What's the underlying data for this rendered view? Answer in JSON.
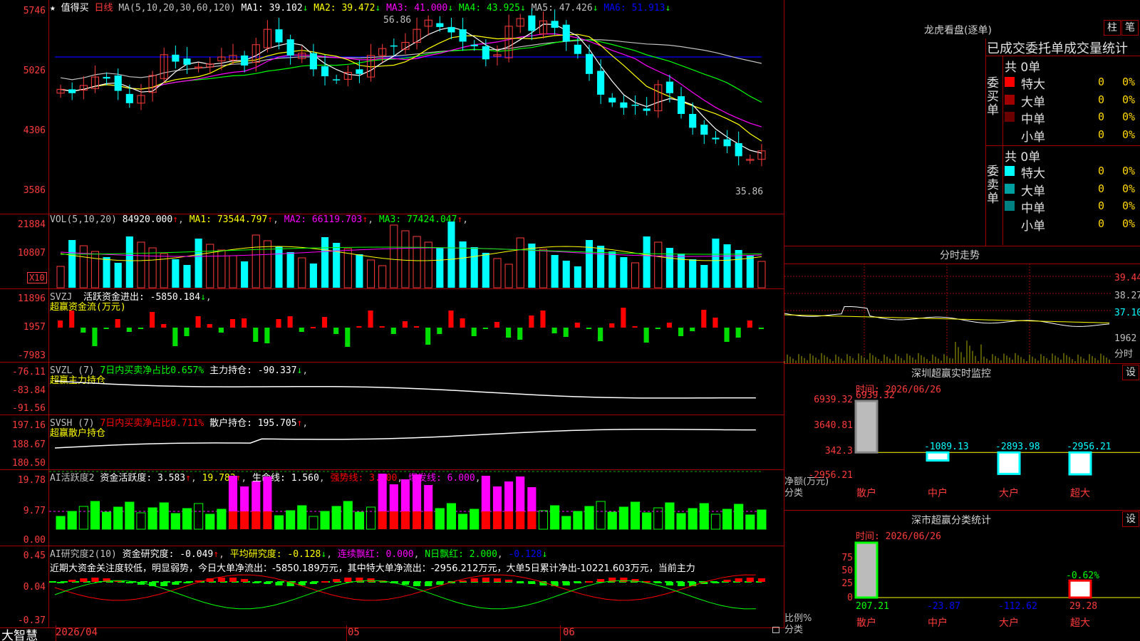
{
  "app": {
    "brand": "大智慧"
  },
  "main_chart": {
    "star": "★",
    "stock_name": "值得买",
    "period": "日线",
    "ma_params": "MA(5,10,20,30,60,120)",
    "ma_values": [
      {
        "name": "MA1:",
        "value": "39.102",
        "arrow": "↓",
        "color": "#ffffff"
      },
      {
        "name": "MA2:",
        "value": "39.472",
        "arrow": "↓",
        "color": "#ffff00"
      },
      {
        "name": "MA3:",
        "value": "41.000",
        "arrow": "↓",
        "color": "#ff00ff"
      },
      {
        "name": "MA4:",
        "value": "43.925",
        "arrow": "↓",
        "color": "#00ff00"
      },
      {
        "name": "MA5:",
        "value": "47.426",
        "arrow": "↓",
        "color": "#c0c0c0"
      },
      {
        "name": "MA6:",
        "value": "51.913",
        "arrow": "↓",
        "color": "#0000ff"
      }
    ],
    "price_axis": [
      "5746",
      "5026",
      "4306",
      "3586"
    ],
    "high_label": "56.86",
    "low_label": "35.86",
    "date_axis": [
      "2026/04",
      "05",
      "06"
    ]
  },
  "vol_panel": {
    "title": "VOL(5,10,20)",
    "value": "84920.000",
    "arrow": "↑",
    "ma": [
      {
        "name": "MA1:",
        "value": "73544.797",
        "arrow": "↑",
        "color": "#ffff00"
      },
      {
        "name": "MA2:",
        "value": "66119.703",
        "arrow": "↑",
        "color": "#ff00ff"
      },
      {
        "name": "MA3:",
        "value": "77424.047",
        "arrow": "↑",
        "color": "#00ff00"
      }
    ],
    "axis": [
      "21884",
      "10807"
    ],
    "unit": "X10"
  },
  "svzj_panel": {
    "title": "SVZJ",
    "label": "活跃资金进出:",
    "value": "-5850.184",
    "arrow": "↓",
    "subtitle": "超赢资金流(万元)",
    "axis": [
      "11896",
      "1957",
      "-7983"
    ]
  },
  "svzl_panel": {
    "title": "SVZL (7)",
    "desc": "7日内买卖净占比0.657%",
    "label": "主力持仓:",
    "value": "-90.337",
    "arrow": "↓",
    "subtitle": "超赢主力持仓",
    "axis": [
      "-76.11",
      "-83.84",
      "-91.56"
    ]
  },
  "svsh_panel": {
    "title": "SVSH (7)",
    "desc": "7日内买卖净占比0.711%",
    "label": "散户持仓:",
    "value": "195.705",
    "arrow": "↑",
    "subtitle": "超赢散户持仓",
    "axis": [
      "197.16",
      "188.67",
      "180.50"
    ]
  },
  "ai_active_panel": {
    "title": "AI活跃度2",
    "label1": "资金活跃度:",
    "value1": "3.583",
    "value2": "19.783",
    "label3": "生命线:",
    "value3": "1.560",
    "label4": "强势线:",
    "value4": "3.000",
    "label5": "爆发线:",
    "value5": "6.000",
    "axis": [
      "19.78",
      "9.77",
      "0.00"
    ]
  },
  "ai_research_panel": {
    "title": "AI研究度2(10)",
    "label1": "资金研究度:",
    "value1": "-0.049",
    "label2": "平均研究度:",
    "value2": "-0.128",
    "label3": "连续飘红:",
    "value3": "0.000",
    "label4": "N日飘红:",
    "value4": "2.000",
    "value5": "-0.128",
    "comment": "近期大资金关注度较低，明显弱势，今日大单净流出：-5850.189万元，其中特大单净流出：-2956.212万元，大单5日累计净出-10221.603万元，当前主力",
    "axis": [
      "0.45",
      "0.04",
      "-0.37"
    ]
  },
  "dragon_tiger": {
    "title": "龙虎看盘(逐单)",
    "btn_bar": "柱",
    "btn_pen": "笔",
    "tabs": "已成交委托单成交量统计",
    "buy_side": "委买单",
    "sell_side": "委卖单",
    "buy_total": "共 0单",
    "sell_total": "共 0单",
    "buy_rows": [
      {
        "label": "特大",
        "count": "0",
        "pct": "0%",
        "color": "#ff0000"
      },
      {
        "label": "大单",
        "count": "0",
        "pct": "0%",
        "color": "#a00000"
      },
      {
        "label": "中单",
        "count": "0",
        "pct": "0%",
        "color": "#6a0000"
      },
      {
        "label": "小单",
        "count": "0",
        "pct": "0%",
        "color": ""
      }
    ],
    "sell_rows": [
      {
        "label": "特大",
        "count": "0",
        "pct": "0%",
        "color": "#00ffff"
      },
      {
        "label": "大单",
        "count": "0",
        "pct": "0%",
        "color": "#00a0a0"
      },
      {
        "label": "中单",
        "count": "0",
        "pct": "0%",
        "color": "#008080"
      },
      {
        "label": "小单",
        "count": "0",
        "pct": "0%",
        "color": ""
      }
    ]
  },
  "intraday": {
    "title": "分时走势",
    "axis": [
      "39.44",
      "38.27",
      "37.10"
    ],
    "vol_label": "1962",
    "vol_unit": "分时"
  },
  "sz_monitor": {
    "title": "深圳超赢实时监控",
    "settings_btn": "设",
    "time_label": "时间: 2026/06/26",
    "axis": [
      "6939.32",
      "3640.81",
      "342.3",
      "-2956.21"
    ],
    "axis_title": "净额(万元)",
    "axis_title2": "分类",
    "categories": [
      "散户",
      "中户",
      "大户",
      "超大"
    ],
    "values": [
      "6939.32",
      "-1089.13",
      "-2893.98",
      "-2956.21"
    ]
  },
  "sz_category": {
    "title": "深市超赢分类统计",
    "settings_btn": "设",
    "time_label": "时间: 2026/06/26",
    "axis": [
      "75",
      "50",
      "25",
      "0"
    ],
    "axis_title": "比例%",
    "axis_title2": "分类",
    "categories": [
      "散户",
      "中户",
      "大户",
      "超大"
    ],
    "values": [
      "207.21",
      "-23.87",
      "-112.62",
      "29.28"
    ],
    "pct_label": "-0.62%"
  },
  "chart_data": [
    {
      "type": "bar",
      "title": "深圳超赢实时监控",
      "categories": [
        "散户",
        "中户",
        "大户",
        "超大"
      ],
      "values": [
        6939.32,
        -1089.13,
        -2893.98,
        -2956.21
      ],
      "ylabel": "净额(万元)",
      "ylim": [
        -2956.21,
        6939.32
      ]
    },
    {
      "type": "bar",
      "title": "深市超赢分类统计",
      "categories": [
        "散户",
        "中户",
        "大户",
        "超大"
      ],
      "values": [
        207.21,
        -23.87,
        -112.62,
        29.28
      ],
      "ylabel": "比例%",
      "ylim": [
        0,
        75
      ]
    }
  ]
}
